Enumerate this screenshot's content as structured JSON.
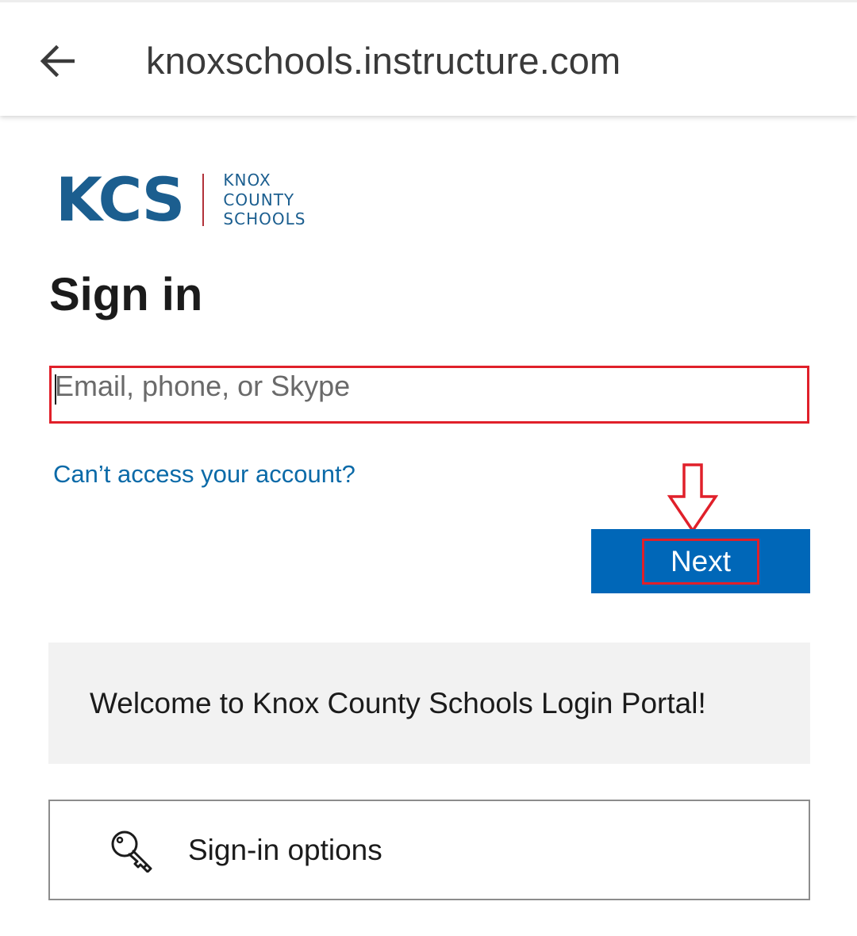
{
  "browser": {
    "back_icon": "arrow-left-icon",
    "url": "knoxschools.instructure.com"
  },
  "logo": {
    "abbr": "KCS",
    "line1": "KNOX",
    "line2": "COUNTY",
    "line3": "SCHOOLS",
    "brand_color": "#1b5e8f",
    "divider_color": "#b2323a"
  },
  "signin": {
    "title": "Sign in",
    "email_placeholder": "Email, phone, or Skype",
    "email_value": "",
    "cant_access_link": "Can’t access your account?",
    "next_label": "Next",
    "next_color": "#0067b8",
    "link_color": "#0b6aa8"
  },
  "welcome": {
    "message": "Welcome to Knox County Schools Login Portal!"
  },
  "options": {
    "icon": "key-icon",
    "label": "Sign-in options"
  },
  "annotations": {
    "highlight_color": "#e0202a",
    "arrow_icon": "down-arrow-annotation"
  }
}
